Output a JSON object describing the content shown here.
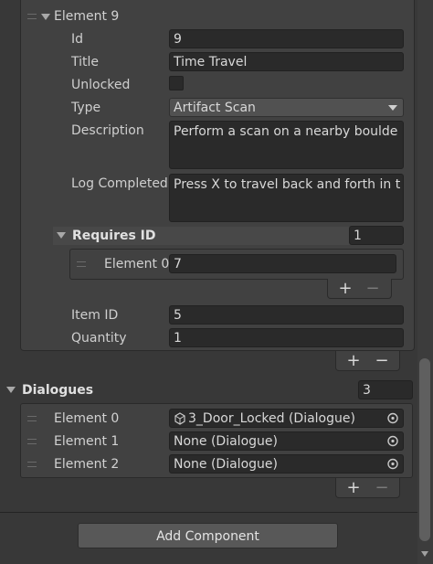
{
  "element9": {
    "header": "Element 9",
    "fields": {
      "id_label": "Id",
      "id_value": "9",
      "title_label": "Title",
      "title_value": "Time Travel",
      "unlocked_label": "Unlocked",
      "type_label": "Type",
      "type_value": "Artifact Scan",
      "description_label": "Description",
      "description_value": "Perform a scan on a nearby boulde",
      "log_label": "Log Completed",
      "log_value": "Press X to travel back and forth in t",
      "requires_label": "Requires ID",
      "requires_count": "1",
      "requires_el0_label": "Element 0",
      "requires_el0_value": "7",
      "itemid_label": "Item ID",
      "itemid_value": "5",
      "quantity_label": "Quantity",
      "quantity_value": "1"
    }
  },
  "dialogues": {
    "label": "Dialogues",
    "count": "3",
    "items": [
      {
        "label": "Element 0",
        "value": "3_Door_Locked (Dialogue)"
      },
      {
        "label": "Element 1",
        "value": "None (Dialogue)"
      },
      {
        "label": "Element 2",
        "value": "None (Dialogue)"
      }
    ]
  },
  "buttons": {
    "plus": "+",
    "minus": "−",
    "add_component": "Add Component"
  }
}
